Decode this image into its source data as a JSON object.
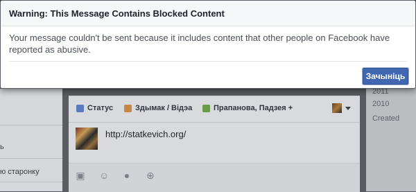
{
  "dialog": {
    "title": "Warning: This Message Contains Blocked Content",
    "message": "Your message couldn't be sent because it includes content that other people on Facebook have reported as abusive.",
    "cancel_label": "Зачыніць"
  },
  "composer": {
    "tabs": [
      {
        "label": "Статус",
        "icon": "pencil-icon"
      },
      {
        "label": "Здымак / Відэа",
        "icon": "photo-icon"
      },
      {
        "label": "Прапанова, Падзея +",
        "icon": "place-icon"
      }
    ],
    "text": "http://statkevich.org/",
    "bottom_icons": [
      "camera-icon",
      "smiley-icon",
      "location-pin-icon",
      "target-icon"
    ]
  },
  "left_column": {
    "items": [
      "ь",
      "ю старонку"
    ]
  },
  "timeline": {
    "years": [
      "2011",
      "2010",
      "Created"
    ]
  },
  "colors": {
    "accent": "#4267b2",
    "dialog_header": "#f6f7f9"
  }
}
